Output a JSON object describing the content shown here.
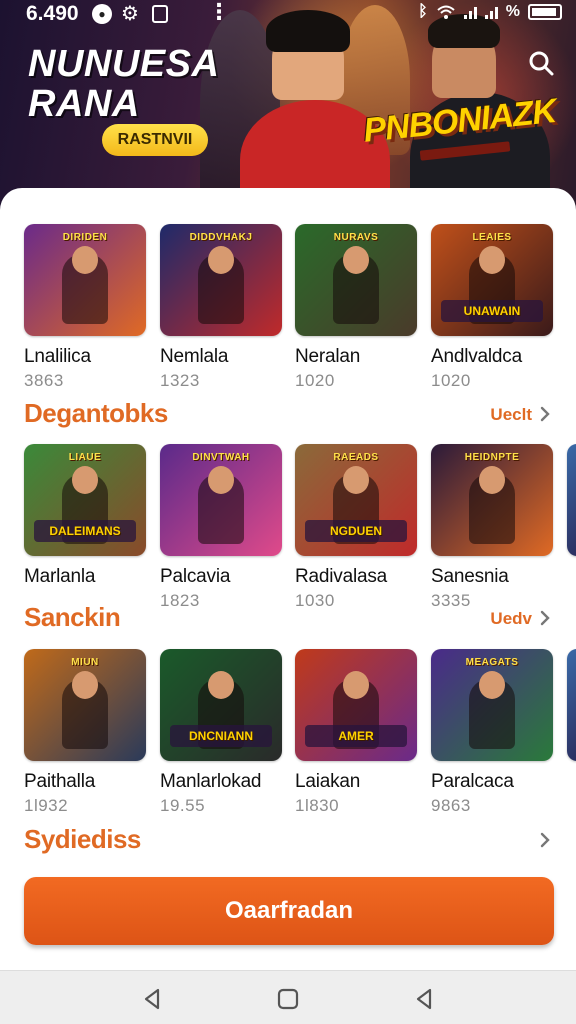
{
  "status_bar": {
    "time": "6.490",
    "battery_label": "%",
    "icons": [
      "notification-icon",
      "settings-icon",
      "calendar-icon",
      "more-dots-icon",
      "bluetooth-icon",
      "wifi-icon",
      "signal-icon",
      "battery-icon"
    ]
  },
  "hero": {
    "title_line1": "NUNUESA",
    "title_line2": "RANA",
    "badge": "RASTNVII",
    "logo": "PNBONIAZK"
  },
  "sections": [
    {
      "title": "",
      "more": "",
      "items": [
        {
          "title": "Lnalilica",
          "count": "3863",
          "thumb_label": "DIRIDEN",
          "thumb_banner": "",
          "colors": [
            "#6a2a8a",
            "#e06a24"
          ]
        },
        {
          "title": "Nemlala",
          "count": "1323",
          "thumb_label": "DIDDVHAKJ",
          "thumb_banner": "",
          "colors": [
            "#1e2a6a",
            "#c02a2a"
          ]
        },
        {
          "title": "Neralan",
          "count": "1020",
          "thumb_label": "NURAVS",
          "thumb_banner": "",
          "colors": [
            "#2a6a2a",
            "#4a3a2a"
          ]
        },
        {
          "title": "Andlvaldca",
          "count": "1020",
          "thumb_label": "LEAIES",
          "thumb_banner": "UNAWAIN",
          "colors": [
            "#c0501a",
            "#3a1a1a"
          ]
        }
      ]
    },
    {
      "title": "Degantobks",
      "more": "Ueclt",
      "items": [
        {
          "title": "Marlanla",
          "count": "",
          "thumb_label": "LIAUE",
          "thumb_banner": "DALEIMANS",
          "colors": [
            "#3a8a3a",
            "#8a4a2a"
          ]
        },
        {
          "title": "Palcavia",
          "count": "1823",
          "thumb_label": "DINVTWAH",
          "thumb_banner": "",
          "colors": [
            "#5a2a8a",
            "#e04a8a"
          ]
        },
        {
          "title": "Radivalasa",
          "count": "1030",
          "thumb_label": "RAEADS",
          "thumb_banner": "NGDUEN",
          "colors": [
            "#8a6a3a",
            "#c02a2a"
          ]
        },
        {
          "title": "Sanesnia",
          "count": "3335",
          "thumb_label": "HEIDNPTE",
          "thumb_banner": "",
          "colors": [
            "#2a1a3a",
            "#e06a24"
          ]
        }
      ]
    },
    {
      "title": "Sanckin",
      "more": "Uedv",
      "items": [
        {
          "title": "Paithalla",
          "count": "1l932",
          "thumb_label": "MIUN",
          "thumb_banner": "",
          "colors": [
            "#c06a1a",
            "#2a3a5a"
          ]
        },
        {
          "title": "Manlarlokad",
          "count": "19.55",
          "thumb_label": "",
          "thumb_banner": "DNCNIANN",
          "colors": [
            "#1a5a2a",
            "#2a2a2a"
          ]
        },
        {
          "title": "Laiakan",
          "count": "1l830",
          "thumb_label": "",
          "thumb_banner": "AMER",
          "colors": [
            "#c03a1a",
            "#6a2a8a"
          ]
        },
        {
          "title": "Paralcaca",
          "count": "9863",
          "thumb_label": "MEAGATS",
          "thumb_banner": "",
          "colors": [
            "#4a2a8a",
            "#2a7a3a"
          ]
        }
      ]
    },
    {
      "title": "Sydiediss",
      "more": "",
      "items": []
    }
  ],
  "cta_label": "Oaarfradan",
  "nav": [
    "back-icon",
    "home-icon",
    "recents-icon"
  ]
}
